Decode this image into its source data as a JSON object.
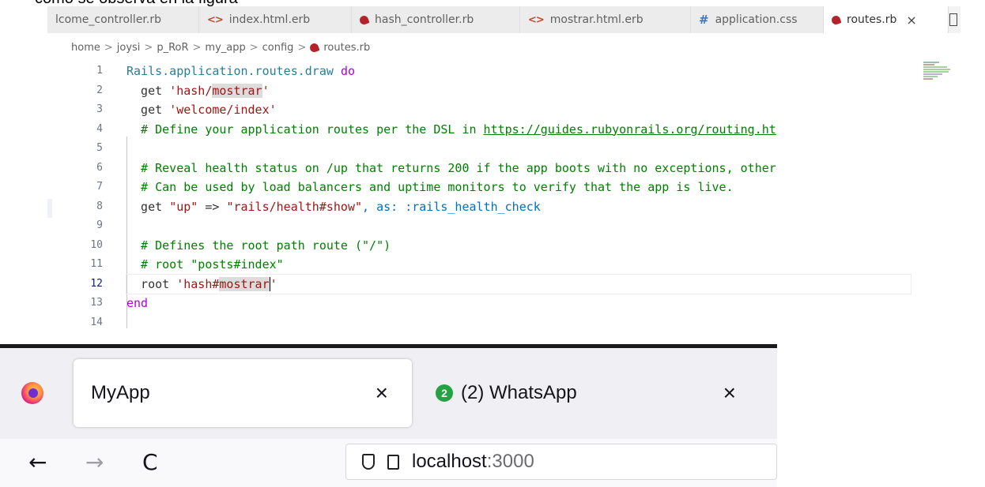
{
  "doc_caption": "como se observa en la figura",
  "editor": {
    "tabs": [
      {
        "label": "lcome_controller.rb",
        "icon": "ruby-file-icon"
      },
      {
        "label": "index.html.erb",
        "icon": "html-file-icon"
      },
      {
        "label": "hash_controller.rb",
        "icon": "ruby-file-icon"
      },
      {
        "label": "mostrar.html.erb",
        "icon": "html-file-icon"
      },
      {
        "label": "application.css",
        "icon": "css-file-icon"
      },
      {
        "label": "routes.rb",
        "icon": "ruby-file-icon",
        "active": true
      }
    ],
    "close_glyph": "×",
    "breadcrumb": [
      "home",
      "joysi",
      "p_RoR",
      "my_app",
      "config",
      "routes.rb"
    ],
    "breadcrumb_sep": ">",
    "line_numbers": [
      "1",
      "2",
      "3",
      "4",
      "5",
      "6",
      "7",
      "8",
      "9",
      "10",
      "11",
      "12",
      "13",
      "14"
    ],
    "current_line": 12,
    "code": {
      "l1_a": "Rails",
      "l1_b": ".application.routes.draw ",
      "l1_c": "do",
      "l2_a": "  get ",
      "l2_b": "'hash/",
      "l2_c": "mostrar",
      "l2_d": "'",
      "l3_a": "  get ",
      "l3_b": "'welcome/index'",
      "l4_a": "  # Define your application routes per the DSL in ",
      "l4_b": "https://guides.rubyonrails.org/routing.ht",
      "l6": "  # Reveal health status on /up that returns 200 if the app boots with no exceptions, other",
      "l7": "  # Can be used by load balancers and uptime monitors to verify that the app is live.",
      "l8_a": "  get ",
      "l8_b": "\"up\"",
      "l8_c": " => ",
      "l8_d": "\"rails/health#show\"",
      "l8_e": ", as: ",
      "l8_f": ":rails_health_check",
      "l10": "  # Defines the root path route (\"/\")",
      "l11": "  # root \"posts#index\"",
      "l12_a": "  root ",
      "l12_b": "'hash#",
      "l12_c": "mostrar",
      "l12_d": "'",
      "l13": "end"
    }
  },
  "browser": {
    "tabs": [
      {
        "title": "MyApp",
        "active": true
      },
      {
        "title": "(2) WhatsApp",
        "badge": "2"
      }
    ],
    "close_glyph": "×",
    "nav": {
      "back": "←",
      "forward": "→",
      "reload": "C"
    },
    "url_host": "localhost",
    "url_port": ":3000"
  }
}
